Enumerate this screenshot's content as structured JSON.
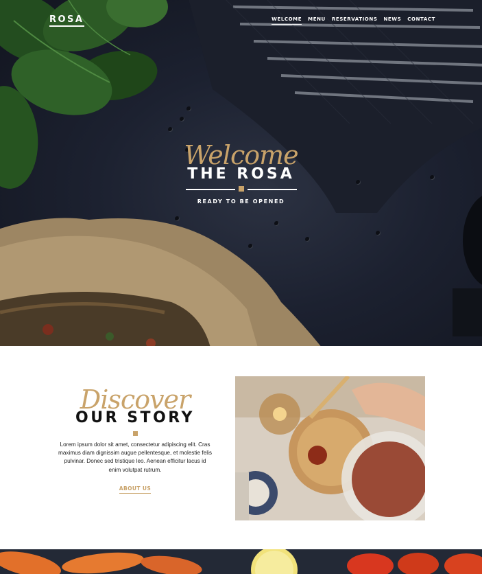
{
  "nav": {
    "logo": "ROSA",
    "items": [
      {
        "label": "WELCOME",
        "active": true
      },
      {
        "label": "MENU",
        "active": false
      },
      {
        "label": "RESERVATIONS",
        "active": false
      },
      {
        "label": "NEWS",
        "active": false
      },
      {
        "label": "CONTACT",
        "active": false
      }
    ]
  },
  "hero": {
    "script": "Welcome",
    "title": "THE ROSA",
    "subtitle": "READY TO BE OPENED"
  },
  "story": {
    "script": "Discover",
    "title": "OUR STORY",
    "body": "Lorem ipsum dolor sit amet, consectetur adipiscing elit. Cras maximus diam dignissim augue pellentesque, et molestie felis pulvinar. Donec sed tristique leo. Aenean efficitur lacus id enim volutpat rutrum.",
    "link": "ABOUT US"
  },
  "colors": {
    "accent": "#c9a36a",
    "hero_bg": "#1c2130",
    "text": "#111111"
  }
}
